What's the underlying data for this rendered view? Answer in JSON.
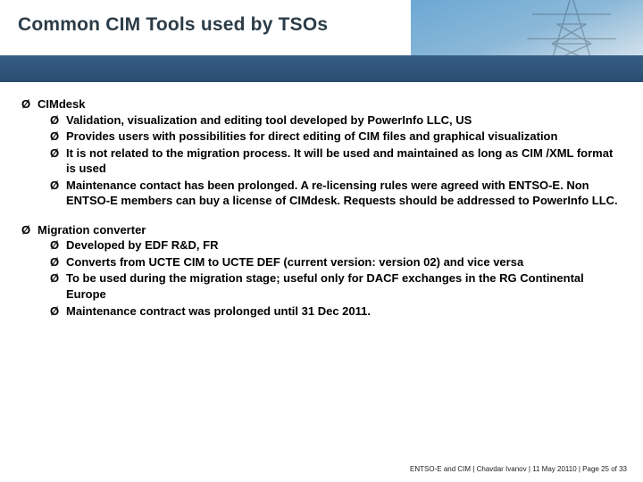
{
  "title": "Common CIM Tools used by TSOs",
  "arrow": "Ø",
  "sections": [
    {
      "heading": "CIMdesk",
      "items": [
        "Validation, visualization and editing tool developed by PowerInfo LLC, US",
        "Provides users with possibilities for direct editing of CIM files and graphical visualization",
        "It is not related to the migration process. It will be used and maintained as long as CIM /XML format is used",
        "Maintenance contact has been prolonged. A re-licensing rules were agreed with ENTSO-E. Non ENTSO-E members can buy a license of CIMdesk. Requests should be addressed to PowerInfo LLC."
      ]
    },
    {
      "heading": "Migration converter",
      "items": [
        "Developed by EDF R&D, FR",
        "Converts from UCTE CIM to UCTE DEF (current version: version 02) and vice versa",
        "To be used during the migration stage; useful only for DACF exchanges in the RG Continental Europe",
        "Maintenance contract was prolonged until 31 Dec 2011."
      ]
    }
  ],
  "footer": "ENTSO-E and CIM | Chavdar Ivanov | 11  May  20110 |  Page  25 of  33"
}
